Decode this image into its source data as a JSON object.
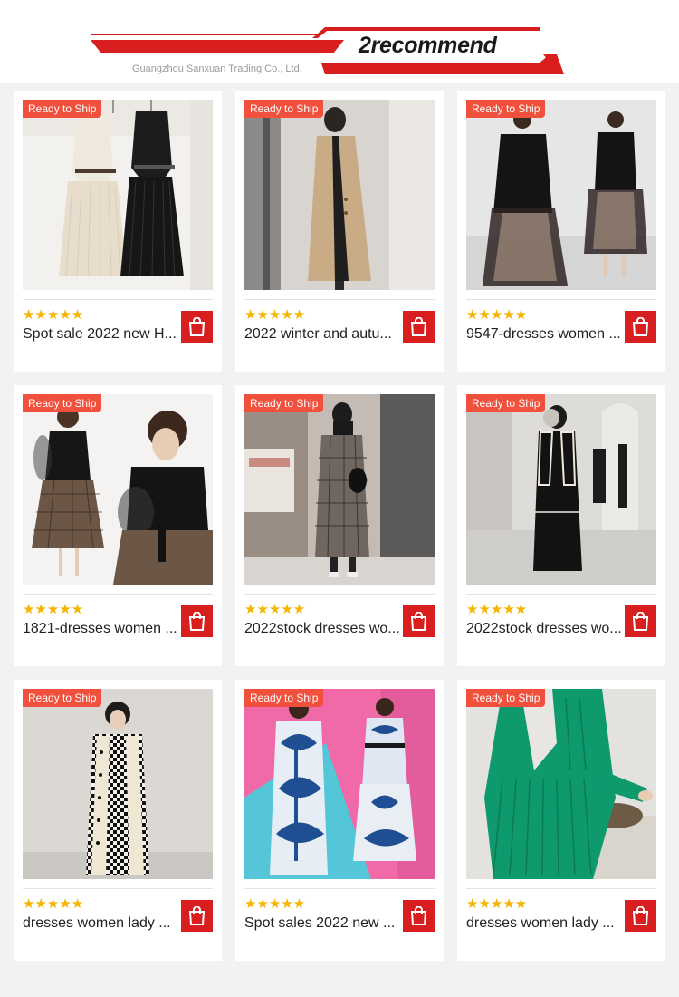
{
  "header": {
    "title": "2recommend",
    "company": "Guangzhou Sanxuan Trading Co., Ltd.",
    "accent_color": "#d81e1e"
  },
  "badge_color": "#f0503c",
  "products": [
    {
      "badge": "Ready to Ship",
      "stars": "★★★★★",
      "rating": 5,
      "title": "Spot sale 2022 new H...",
      "icon": "shopping-bag-icon",
      "image": "two-tone-blazer-pleated-dress"
    },
    {
      "badge": "Ready to Ship",
      "stars": "★★★★★",
      "rating": 5,
      "title": "2022 winter and autu...",
      "icon": "shopping-bag-icon",
      "image": "camel-long-coat"
    },
    {
      "badge": "Ready to Ship",
      "stars": "★★★★★",
      "rating": 5,
      "title": "9547-dresses women ...",
      "icon": "shopping-bag-icon",
      "image": "black-blazer-tulle-dress"
    },
    {
      "badge": "Ready to Ship",
      "stars": "★★★★★",
      "rating": 5,
      "title": "1821-dresses women ...",
      "icon": "shopping-bag-icon",
      "image": "sheer-sleeve-plaid-dress"
    },
    {
      "badge": "Ready to Ship",
      "stars": "★★★★★",
      "rating": 5,
      "title": "2022stock dresses wo...",
      "icon": "shopping-bag-icon",
      "image": "plaid-long-coat"
    },
    {
      "badge": "Ready to Ship",
      "stars": "★★★★★",
      "rating": 5,
      "title": "2022stock dresses wo...",
      "icon": "shopping-bag-icon",
      "image": "black-coat-dress"
    },
    {
      "badge": "Ready to Ship",
      "stars": "★★★★★",
      "rating": 5,
      "title": "dresses women lady ...",
      "icon": "shopping-bag-icon",
      "image": "houndstooth-cardigan-dress"
    },
    {
      "badge": "Ready to Ship",
      "stars": "★★★★★",
      "rating": 5,
      "title": "Spot sales 2022 new ...",
      "icon": "shopping-bag-icon",
      "image": "blue-print-shirt-skirt"
    },
    {
      "badge": "Ready to Ship",
      "stars": "★★★★★",
      "rating": 5,
      "title": "dresses women lady ...",
      "icon": "shopping-bag-icon",
      "image": "green-knit-set"
    }
  ]
}
